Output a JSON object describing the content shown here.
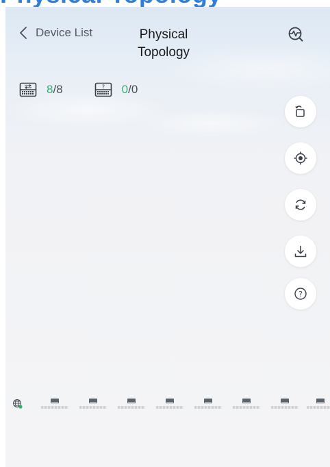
{
  "header": {
    "back_label": "Device List",
    "title": "Physical\nTopology"
  },
  "top_banner_text": "Physical Topology",
  "stats": [
    {
      "icon": "switch-icon",
      "online": "8",
      "total": "/8"
    },
    {
      "icon": "unknown-device-icon",
      "online": "0",
      "total": "/0"
    }
  ],
  "toolbar": [
    {
      "name": "rotate-layout-button",
      "icon": "rotate-icon"
    },
    {
      "name": "locate-button",
      "icon": "target-icon"
    },
    {
      "name": "refresh-button",
      "icon": "refresh-icon"
    },
    {
      "name": "download-button",
      "icon": "download-icon"
    },
    {
      "name": "help-button",
      "icon": "help-icon"
    }
  ],
  "colors": {
    "accent_green": "#2fb36c",
    "banner_blue": "#2f7fd8",
    "text_dark": "#1a1a1a",
    "text_gray": "#555a63"
  },
  "devices_count": 8
}
